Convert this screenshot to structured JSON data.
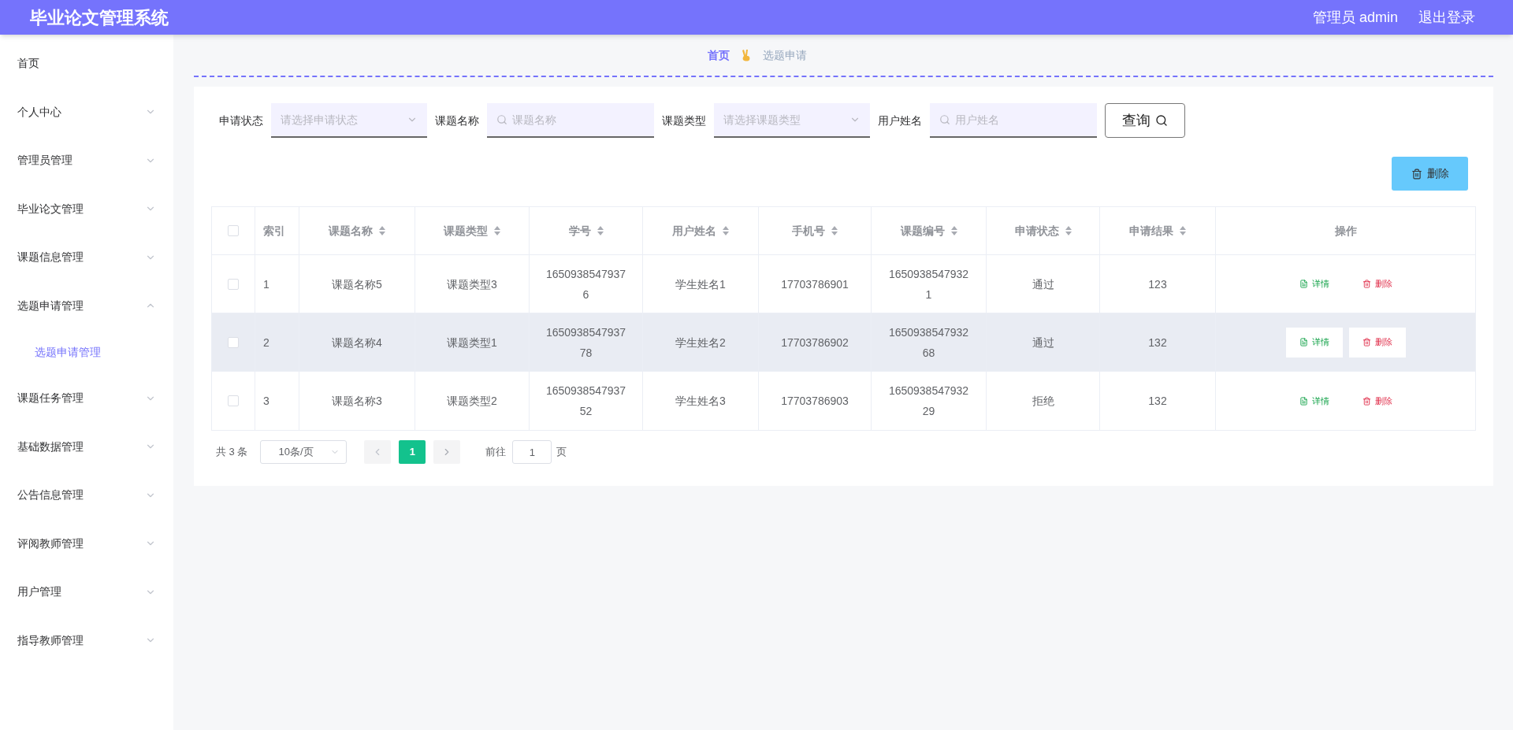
{
  "header": {
    "title": "毕业论文管理系统",
    "user": "管理员 admin",
    "logout": "退出登录"
  },
  "sidebar": {
    "items": [
      {
        "label": "首页",
        "has_children": false
      },
      {
        "label": "个人中心",
        "has_children": true,
        "expanded": false
      },
      {
        "label": "管理员管理",
        "has_children": true,
        "expanded": false
      },
      {
        "label": "毕业论文管理",
        "has_children": true,
        "expanded": false
      },
      {
        "label": "课题信息管理",
        "has_children": true,
        "expanded": false
      },
      {
        "label": "选题申请管理",
        "has_children": true,
        "expanded": true,
        "children": [
          {
            "label": "选题申请管理",
            "selected": true
          }
        ]
      },
      {
        "label": "课题任务管理",
        "has_children": true,
        "expanded": false
      },
      {
        "label": "基础数据管理",
        "has_children": true,
        "expanded": false
      },
      {
        "label": "公告信息管理",
        "has_children": true,
        "expanded": false
      },
      {
        "label": "评阅教师管理",
        "has_children": true,
        "expanded": false
      },
      {
        "label": "用户管理",
        "has_children": true,
        "expanded": false
      },
      {
        "label": "指导教师管理",
        "has_children": true,
        "expanded": false
      }
    ]
  },
  "breadcrumb": {
    "home": "首页",
    "current": "选题申请"
  },
  "filters": [
    {
      "kind": "select",
      "label": "申请状态",
      "placeholder": "请选择申请状态"
    },
    {
      "kind": "search",
      "label": "课题名称",
      "placeholder": "课题名称"
    },
    {
      "kind": "select",
      "label": "课题类型",
      "placeholder": "请选择课题类型"
    },
    {
      "kind": "search",
      "label": "用户姓名",
      "placeholder": "用户姓名"
    }
  ],
  "query_button": "查询",
  "delete_button": "删除",
  "table": {
    "all_checked": false,
    "columns": [
      {
        "label": "索引",
        "sortable": false
      },
      {
        "label": "课题名称",
        "sortable": true
      },
      {
        "label": "课题类型",
        "sortable": true
      },
      {
        "label": "学号",
        "sortable": true
      },
      {
        "label": "用户姓名",
        "sortable": true
      },
      {
        "label": "手机号",
        "sortable": true
      },
      {
        "label": "课题编号",
        "sortable": true
      },
      {
        "label": "申请状态",
        "sortable": true
      },
      {
        "label": "申请结果",
        "sortable": true
      },
      {
        "label": "操作",
        "sortable": false
      }
    ],
    "rows": [
      {
        "checked": false,
        "highlighted": false,
        "cells": [
          "1",
          "课题名称5",
          "课题类型3",
          "16509385479376",
          "学生姓名1",
          "17703786901",
          "16509385479321",
          "通过",
          "123"
        ],
        "actions": [
          "详情",
          "删除"
        ]
      },
      {
        "checked": false,
        "highlighted": true,
        "cells": [
          "2",
          "课题名称4",
          "课题类型1",
          "165093854793778",
          "学生姓名2",
          "17703786902",
          "165093854793268",
          "通过",
          "132"
        ],
        "actions": [
          "详情",
          "删除"
        ]
      },
      {
        "checked": false,
        "highlighted": false,
        "cells": [
          "3",
          "课题名称3",
          "课题类型2",
          "165093854793752",
          "学生姓名3",
          "17703786903",
          "165093854793229",
          "拒绝",
          "132"
        ],
        "actions": [
          "详情",
          "删除"
        ]
      }
    ]
  },
  "pagination": {
    "total": "共 3 条",
    "page_size": "10条/页",
    "pages": [
      {
        "label": "1",
        "selected": true
      }
    ],
    "goto_label": "前往",
    "goto_value": "1",
    "page_suffix": "页"
  }
}
